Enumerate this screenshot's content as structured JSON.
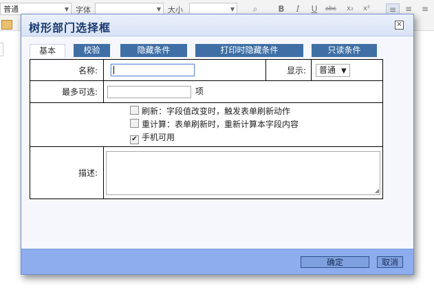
{
  "background_toolbar": {
    "style_select": "普通",
    "font_label": "字体",
    "size_label": "大小",
    "buttons": [
      "B",
      "I",
      "U",
      "abc",
      "x₂",
      "x²"
    ]
  },
  "dialog": {
    "title": "树形部门选择框",
    "close_glyph": "×",
    "tabs": [
      {
        "label": "基本",
        "active": true
      },
      {
        "label": "校验",
        "active": false
      },
      {
        "label": "隐藏条件",
        "active": false
      },
      {
        "label": "打印时隐藏条件",
        "active": false
      },
      {
        "label": "只读条件",
        "active": false
      }
    ],
    "form": {
      "name_label": "名称:",
      "name_value": "",
      "display_label": "显示:",
      "display_value": "普通",
      "max_select_label": "最多可选:",
      "max_select_value": "",
      "max_select_unit": "项",
      "checkboxes": [
        {
          "label": "刷新：字段值改变时，触发表单刷新动作",
          "checked": false
        },
        {
          "label": "重计算：表单刷新时，重新计算本字段内容",
          "checked": false
        },
        {
          "label": "手机可用",
          "checked": true
        }
      ],
      "description_label": "描述:",
      "description_value": ""
    },
    "footer": {
      "ok_label": "确定",
      "cancel_label": "取消"
    }
  },
  "colors": {
    "title_text": "#16386e",
    "tab_bg": "#3f6fa5",
    "footer_bg": "#8eadee",
    "button_bg": "#7ea0de"
  }
}
